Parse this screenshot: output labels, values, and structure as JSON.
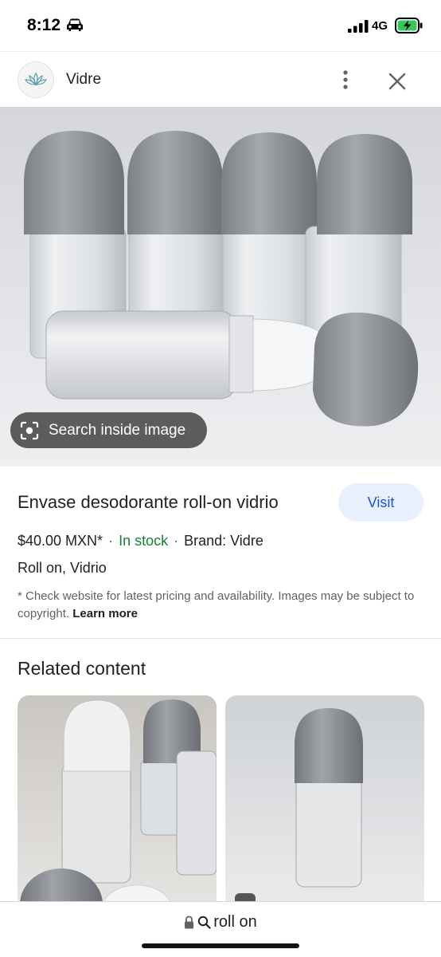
{
  "status_bar": {
    "time": "8:12",
    "network": "4G",
    "icons": [
      "car-icon",
      "signal-icon",
      "battery-charging-icon"
    ]
  },
  "site": {
    "name": "Vidre",
    "logo_icon": "lotus-logo-icon",
    "menu_icon": "more-vert-icon",
    "close_icon": "close-icon"
  },
  "hero": {
    "search_inside_label": "Search inside image",
    "lens_icon": "lens-icon"
  },
  "product": {
    "title": "Envase desodorante roll-on vidrio",
    "visit_label": "Visit",
    "price": "$40.00 MXN*",
    "stock": "In stock",
    "brand": "Brand: Vidre",
    "categories": "Roll on, Vidrio",
    "disclaimer": "* Check website for latest pricing and availability. Images may be subject to copyright.",
    "learn_more": "Learn more",
    "stock_color": "#188038",
    "visit_color": "#1a56c8"
  },
  "related": {
    "title": "Related content"
  },
  "url_bar": {
    "query": "roll on",
    "icons": [
      "lock-icon",
      "search-icon"
    ]
  }
}
